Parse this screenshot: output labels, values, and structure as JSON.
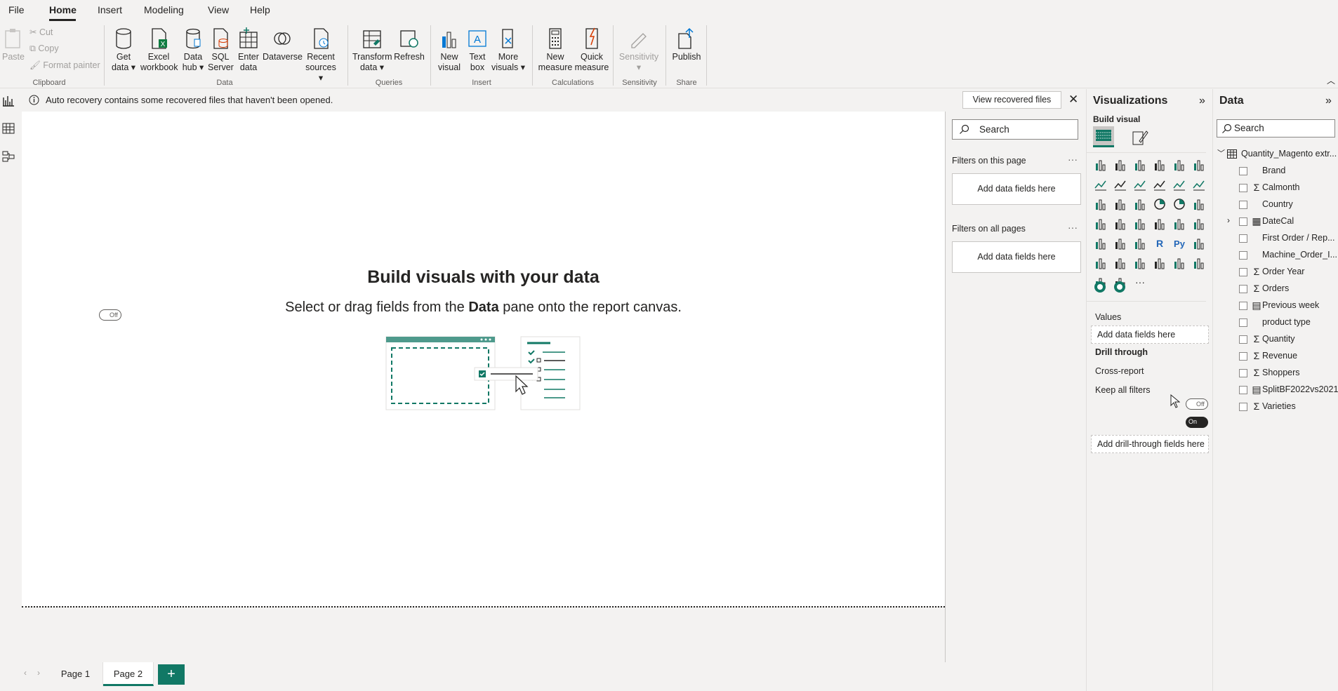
{
  "menu": {
    "items": [
      "File",
      "Home",
      "Insert",
      "Modeling",
      "View",
      "Help"
    ],
    "active": "Home"
  },
  "ribbon": {
    "clipboard": {
      "paste": "Paste",
      "cut": "Cut",
      "copy": "Copy",
      "format_painter": "Format painter",
      "label": "Clipboard"
    },
    "data": {
      "get_data": [
        "Get",
        "data"
      ],
      "excel": [
        "Excel",
        "workbook"
      ],
      "data_hub": [
        "Data",
        "hub"
      ],
      "sql": [
        "SQL",
        "Server"
      ],
      "enter_data": [
        "Enter",
        "data"
      ],
      "dataverse": "Dataverse",
      "recent": [
        "Recent",
        "sources"
      ],
      "label": "Data"
    },
    "queries": {
      "transform": [
        "Transform",
        "data"
      ],
      "refresh": "Refresh",
      "label": "Queries"
    },
    "insert": {
      "new_visual": [
        "New",
        "visual"
      ],
      "text_box": [
        "Text",
        "box"
      ],
      "more_visuals": [
        "More",
        "visuals"
      ],
      "label": "Insert"
    },
    "calculations": {
      "new_measure": [
        "New",
        "measure"
      ],
      "quick_measure": [
        "Quick",
        "measure"
      ],
      "label": "Calculations"
    },
    "sensitivity": {
      "sensitivity": "Sensitivity",
      "label": "Sensitivity"
    },
    "share": {
      "publish": "Publish",
      "label": "Share"
    }
  },
  "notification": {
    "text": "Auto recovery contains some recovered files that haven't been opened.",
    "button": "View recovered files"
  },
  "canvas": {
    "title": "Build visuals with your data",
    "subtitle_pre": "Select or drag fields from the ",
    "subtitle_bold": "Data",
    "subtitle_post": " pane onto the report canvas."
  },
  "filters": {
    "search_placeholder": "Search",
    "on_this_page": "Filters on this page",
    "on_all_pages": "Filters on all pages",
    "add_fields": "Add data fields here",
    "more": "···"
  },
  "visualizations": {
    "title": "Visualizations",
    "build_visual": "Build visual",
    "values": "Values",
    "add_fields": "Add data fields here",
    "drill_through": "Drill through",
    "cross_report": "Cross-report",
    "cross_report_state": "Off",
    "keep_all_filters": "Keep all filters",
    "keep_all_filters_state": "On",
    "add_drill": "Add drill-through fields here",
    "more": "···"
  },
  "data_pane": {
    "title": "Data",
    "search_placeholder": "Search",
    "table_name": "Quantity_Magento extr...",
    "fields": [
      {
        "label": "Brand",
        "icon": ""
      },
      {
        "label": "Calmonth",
        "icon": "sigma"
      },
      {
        "label": "Country",
        "icon": ""
      },
      {
        "label": "DateCal",
        "icon": "table",
        "expandable": true
      },
      {
        "label": "First Order / Rep...",
        "icon": ""
      },
      {
        "label": "Machine_Order_I...",
        "icon": ""
      },
      {
        "label": "Order Year",
        "icon": "sigma"
      },
      {
        "label": "Orders",
        "icon": "sigma"
      },
      {
        "label": "Previous week",
        "icon": "calc"
      },
      {
        "label": "product type",
        "icon": ""
      },
      {
        "label": "Quantity",
        "icon": "sigma"
      },
      {
        "label": "Revenue",
        "icon": "sigma"
      },
      {
        "label": "Shoppers",
        "icon": "sigma"
      },
      {
        "label": "SplitBF2022vs2021",
        "icon": "calc"
      },
      {
        "label": "Varieties",
        "icon": "sigma"
      }
    ]
  },
  "pages": {
    "tabs": [
      "Page 1",
      "Page 2"
    ],
    "active": "Page 2",
    "add": "+"
  },
  "colors": {
    "accent": "#117865",
    "background": "#f3f2f1",
    "canvas": "#ffffff"
  }
}
